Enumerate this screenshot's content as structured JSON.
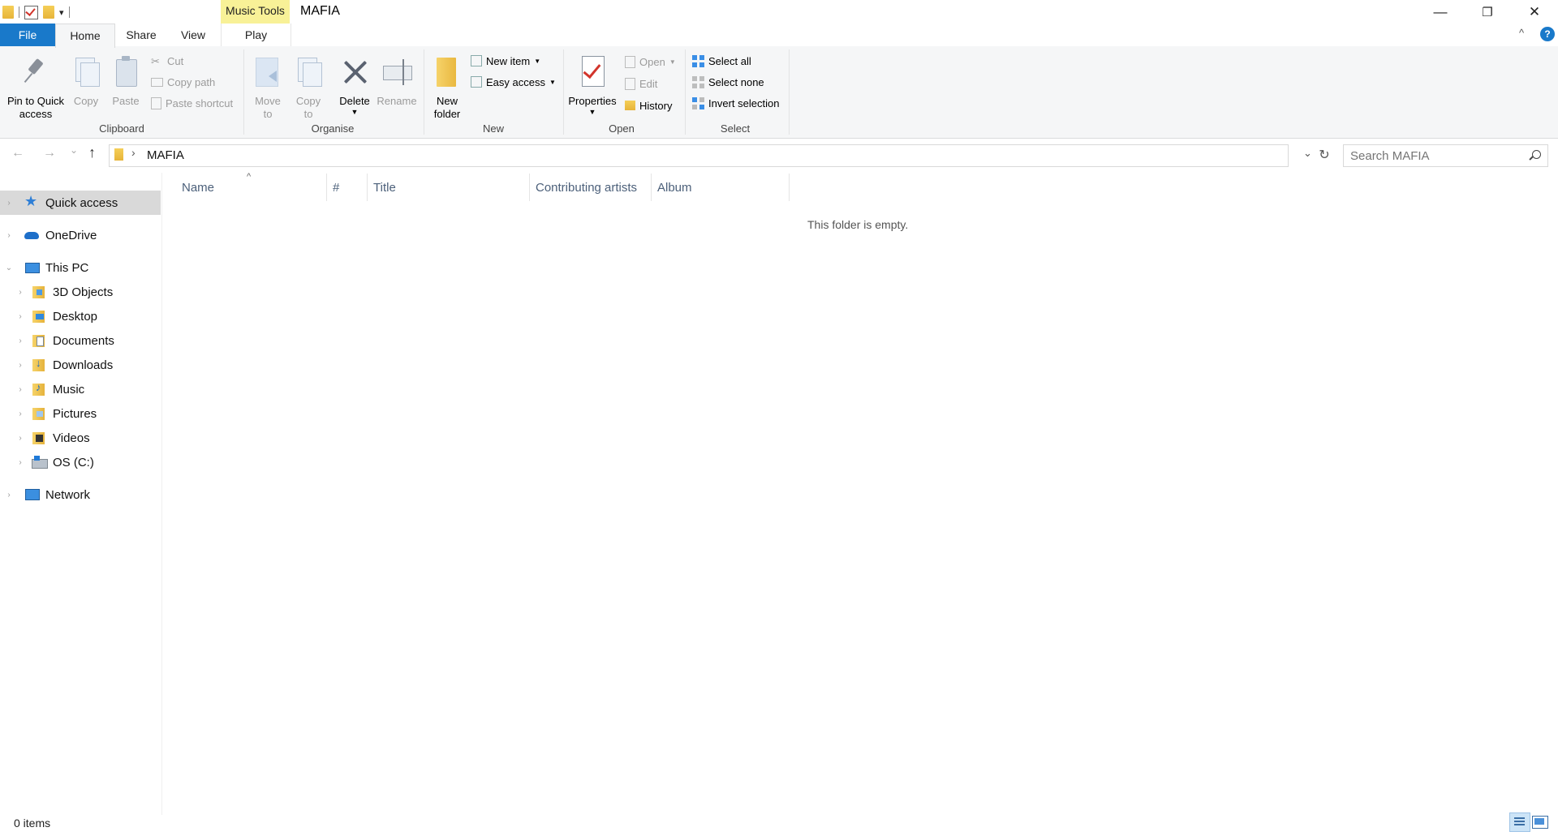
{
  "window": {
    "title": "MAFIA",
    "contextual_tab_group": "Music Tools",
    "controls": {
      "minimize": "—",
      "maximize": "❐",
      "close": "✕"
    }
  },
  "quick_access_toolbar": {
    "customize_arrow": "▾"
  },
  "tabs": {
    "file": "File",
    "home": "Home",
    "share": "Share",
    "view": "View",
    "play": "Play"
  },
  "ribbon": {
    "collapse": "^",
    "help": "?",
    "clipboard": {
      "label": "Clipboard",
      "pin": "Pin to Quick access",
      "copy": "Copy",
      "paste": "Paste",
      "cut": "Cut",
      "copy_path": "Copy path",
      "paste_shortcut": "Paste shortcut"
    },
    "organise": {
      "label": "Organise",
      "move_to": "Move to",
      "copy_to": "Copy to",
      "delete": "Delete",
      "rename": "Rename"
    },
    "new": {
      "label": "New",
      "new_folder": "New folder",
      "new_item": "New item",
      "easy_access": "Easy access"
    },
    "open": {
      "label": "Open",
      "properties": "Properties",
      "open": "Open",
      "edit": "Edit",
      "history": "History"
    },
    "select": {
      "label": "Select",
      "select_all": "Select all",
      "select_none": "Select none",
      "invert_selection": "Invert selection"
    }
  },
  "address_bar": {
    "back": "←",
    "forward": "→",
    "recent": "⌄",
    "up": "↑",
    "chevron": "›",
    "path": "MAFIA",
    "dropdown": "⌄",
    "refresh": "↻"
  },
  "search": {
    "placeholder": "Search MAFIA"
  },
  "navigation_pane": {
    "items": [
      {
        "label": "Quick access",
        "icon": "star-icon"
      },
      {
        "label": "OneDrive",
        "icon": "cloud-icon"
      },
      {
        "label": "This PC",
        "icon": "computer-icon"
      },
      {
        "label": "3D Objects",
        "icon": "3d-objects-folder-icon"
      },
      {
        "label": "Desktop",
        "icon": "desktop-folder-icon"
      },
      {
        "label": "Documents",
        "icon": "documents-folder-icon"
      },
      {
        "label": "Downloads",
        "icon": "downloads-folder-icon"
      },
      {
        "label": "Music",
        "icon": "music-folder-icon"
      },
      {
        "label": "Pictures",
        "icon": "pictures-folder-icon"
      },
      {
        "label": "Videos",
        "icon": "videos-folder-icon"
      },
      {
        "label": "OS (C:)",
        "icon": "drive-icon"
      },
      {
        "label": "Network",
        "icon": "network-icon"
      }
    ]
  },
  "file_list": {
    "columns": [
      "Name",
      "#",
      "Title",
      "Contributing artists",
      "Album"
    ],
    "sort_indicator": "^",
    "empty_message": "This folder is empty."
  },
  "status_bar": {
    "item_count": "0 items"
  },
  "colors": {
    "file_tab": "#1979ca",
    "music_tools": "#f8f197",
    "ribbon_bg": "#f5f6f7",
    "selected_nav": "#d9d9d9",
    "column_header_text": "#4c607a"
  }
}
